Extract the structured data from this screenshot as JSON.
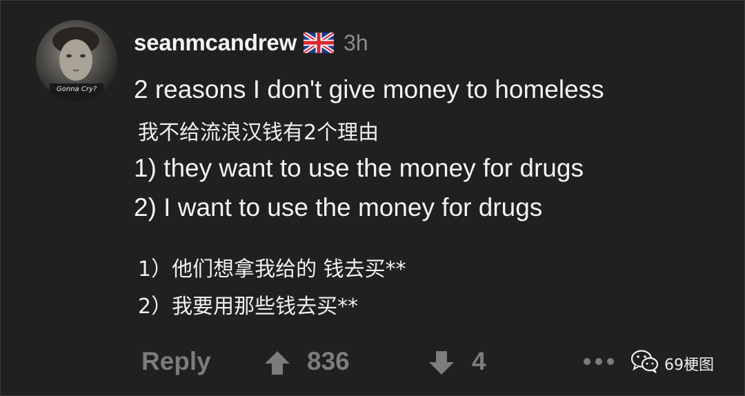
{
  "comment": {
    "username": "seanmcandrew",
    "flag_icon": "uk-flag-icon",
    "timestamp": "3h",
    "avatar_caption": "Gonna Cry?",
    "lines": [
      "2 reasons I don't give money to homeless",
      "我不给流浪汉钱有2个理由",
      "1) they want to use the money for drugs",
      "2) I want to use the money for drugs",
      "1）他们想拿我给的 钱去买**",
      "2）我要用那些钱去买**"
    ]
  },
  "actions": {
    "reply_label": "Reply",
    "upvote_icon": "arrow-up-icon",
    "upvote_count": "836",
    "downvote_icon": "arrow-down-icon",
    "downvote_count": "4",
    "more_icon": "more-dots-icon"
  },
  "watermark": {
    "icon": "wechat-icon",
    "text": "69梗图"
  },
  "colors": {
    "background": "#202020",
    "text": "#f2f2f2",
    "muted": "#7c7c7c",
    "timestamp": "#8b8b8b"
  }
}
